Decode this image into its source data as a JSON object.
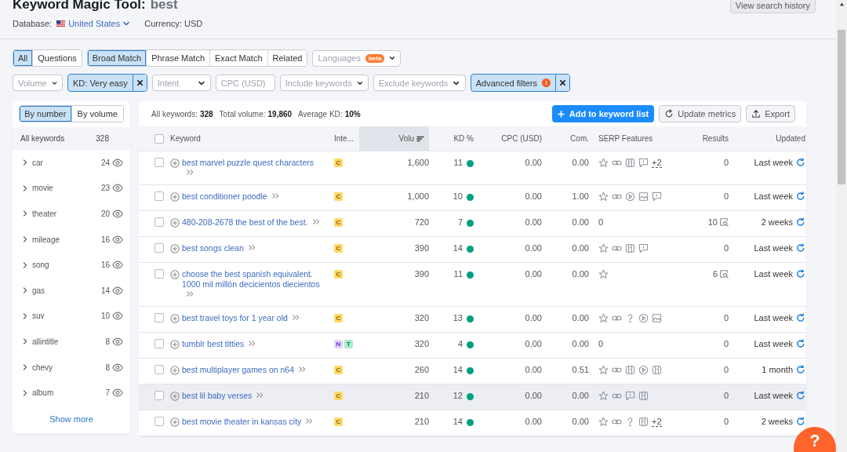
{
  "header": {
    "title": "Keyword Magic Tool:",
    "query": "best",
    "database_label": "Database:",
    "database": "United States",
    "currency": "Currency: USD",
    "history_button": "View search history"
  },
  "type_tabs": [
    {
      "label": "All",
      "selected": true
    },
    {
      "label": "Questions",
      "selected": false
    }
  ],
  "match_tabs": [
    {
      "label": "Broad Match",
      "selected": true
    },
    {
      "label": "Phrase Match",
      "selected": false
    },
    {
      "label": "Exact Match",
      "selected": false
    },
    {
      "label": "Related",
      "selected": false
    }
  ],
  "languages": {
    "placeholder": "Languages",
    "badge": "beta"
  },
  "filters": [
    {
      "label": "Volume",
      "kind": "dropdown"
    },
    {
      "label": "KD: Very easy",
      "kind": "active"
    },
    {
      "label": "Intent",
      "kind": "dropdown"
    },
    {
      "label": "CPC (USD)",
      "kind": "dropdown"
    },
    {
      "label": "Include keywords",
      "kind": "dropdown"
    },
    {
      "label": "Exclude keywords",
      "kind": "dropdown"
    },
    {
      "label": "Advanced filters",
      "kind": "active",
      "badge": "1"
    }
  ],
  "sidebar": {
    "sort_tabs": [
      {
        "label": "By number",
        "selected": true
      },
      {
        "label": "By volume",
        "selected": false
      }
    ],
    "all_label": "All keywords",
    "all_count": "328",
    "groups": [
      {
        "name": "car",
        "count": "24"
      },
      {
        "name": "movie",
        "count": "23"
      },
      {
        "name": "theater",
        "count": "20"
      },
      {
        "name": "mileage",
        "count": "16"
      },
      {
        "name": "song",
        "count": "16"
      },
      {
        "name": "gas",
        "count": "14"
      },
      {
        "name": "suv",
        "count": "10"
      },
      {
        "name": "allintitle",
        "count": "8"
      },
      {
        "name": "chevy",
        "count": "8"
      },
      {
        "name": "album",
        "count": "7"
      }
    ],
    "show_more": "Show more"
  },
  "summary": [
    {
      "label": "All keywords:",
      "value": "328"
    },
    {
      "label": "Total volume:",
      "value": "19,860"
    },
    {
      "label": "Average KD:",
      "value": "10%"
    }
  ],
  "actions": {
    "add": "Add to keyword list",
    "update": "Update metrics",
    "export": "Export"
  },
  "select_all_checked": false,
  "columns": [
    {
      "label": "Keyword",
      "sorted": false
    },
    {
      "label": "Inte...",
      "sorted": false
    },
    {
      "label": "Volu",
      "sorted": true
    },
    {
      "label": "KD %",
      "sorted": false
    },
    {
      "label": "CPC (USD)",
      "sorted": false
    },
    {
      "label": "Com.",
      "sorted": false
    },
    {
      "label": "SERP Features",
      "sorted": false
    },
    {
      "label": "Results",
      "sorted": false
    },
    {
      "label": "Updated",
      "sorted": false
    }
  ],
  "rows": [
    {
      "keyword": "best marvel puzzle quest characters",
      "checked": false,
      "highlighted": false,
      "intents": [
        {
          "letter": "C",
          "kind": "commercial"
        }
      ],
      "volume": "1,600",
      "kd": "11",
      "cpc": "0.00",
      "com": "0.00",
      "serp": [
        {
          "kind": "star"
        },
        {
          "kind": "link"
        },
        {
          "kind": "card"
        },
        {
          "kind": "review"
        }
      ],
      "serp_more": "+2",
      "results": "0",
      "snapshot": false,
      "updated": "Last week"
    },
    {
      "keyword": "best conditioner poodle",
      "checked": false,
      "highlighted": false,
      "intents": [
        {
          "letter": "C",
          "kind": "commercial"
        }
      ],
      "volume": "1,000",
      "kd": "10",
      "cpc": "0.00",
      "com": "1.00",
      "serp": [
        {
          "kind": "star"
        },
        {
          "kind": "link"
        },
        {
          "kind": "video"
        },
        {
          "kind": "image"
        },
        {
          "kind": "review"
        }
      ],
      "results": "0",
      "snapshot": false,
      "updated": "Last week"
    },
    {
      "keyword": "480-208-2678 the best of the best.",
      "checked": false,
      "highlighted": false,
      "intents": [
        {
          "letter": "C",
          "kind": "commercial"
        }
      ],
      "volume": "720",
      "kd": "7",
      "cpc": "0.00",
      "com": "0.00",
      "serp_text": "0",
      "results": "10",
      "snapshot": true,
      "updated": "2 weeks"
    },
    {
      "keyword": "best songs clean",
      "checked": false,
      "highlighted": false,
      "intents": [
        {
          "letter": "C",
          "kind": "commercial"
        }
      ],
      "volume": "390",
      "kd": "14",
      "cpc": "0.00",
      "com": "0.00",
      "serp": [
        {
          "kind": "star"
        },
        {
          "kind": "link"
        },
        {
          "kind": "card"
        },
        {
          "kind": "review"
        }
      ],
      "results": "0",
      "snapshot": false,
      "updated": "Last week"
    },
    {
      "keyword": "choose the best spanish equivalent. 1000 mil millón decicientos diecientos",
      "checked": false,
      "highlighted": false,
      "intents": [
        {
          "letter": "C",
          "kind": "commercial"
        }
      ],
      "volume": "390",
      "kd": "11",
      "cpc": "0.00",
      "com": "0.00",
      "serp": [
        {
          "kind": "star"
        }
      ],
      "results": "6",
      "snapshot": true,
      "updated": "Last week"
    },
    {
      "keyword": "best travel toys for 1 year old",
      "checked": false,
      "highlighted": false,
      "intents": [
        {
          "letter": "C",
          "kind": "commercial"
        }
      ],
      "volume": "320",
      "kd": "13",
      "cpc": "0.00",
      "com": "0.00",
      "serp": [
        {
          "kind": "star"
        },
        {
          "kind": "link"
        },
        {
          "kind": "question"
        },
        {
          "kind": "video"
        },
        {
          "kind": "image"
        }
      ],
      "results": "0",
      "snapshot": false,
      "updated": "Last week"
    },
    {
      "keyword": "tumblr best titties",
      "checked": false,
      "highlighted": false,
      "intents": [
        {
          "letter": "N",
          "kind": "navigational"
        },
        {
          "letter": "T",
          "kind": "transactional"
        }
      ],
      "volume": "320",
      "kd": "4",
      "cpc": "0.00",
      "com": "0.00",
      "serp_text": "0",
      "results": "0",
      "snapshot": false,
      "updated": "Last week"
    },
    {
      "keyword": "best multiplayer games on n64",
      "checked": false,
      "highlighted": false,
      "intents": [
        {
          "letter": "C",
          "kind": "commercial"
        }
      ],
      "volume": "260",
      "kd": "14",
      "cpc": "0.00",
      "com": "0.51",
      "serp": [
        {
          "kind": "star"
        },
        {
          "kind": "link"
        },
        {
          "kind": "card"
        },
        {
          "kind": "video"
        },
        {
          "kind": "card"
        }
      ],
      "results": "0",
      "snapshot": false,
      "updated": "1 month"
    },
    {
      "keyword": "best lil baby verses",
      "checked": false,
      "highlighted": true,
      "intents": [
        {
          "letter": "C",
          "kind": "commercial"
        }
      ],
      "volume": "210",
      "kd": "12",
      "cpc": "0.00",
      "com": "0.00",
      "serp": [
        {
          "kind": "star"
        },
        {
          "kind": "link"
        },
        {
          "kind": "review"
        },
        {
          "kind": "card"
        }
      ],
      "results": "0",
      "snapshot": false,
      "updated": "Last week"
    },
    {
      "keyword": "best movie theater in kansas city",
      "checked": false,
      "highlighted": false,
      "intents": [
        {
          "letter": "C",
          "kind": "commercial"
        }
      ],
      "volume": "210",
      "kd": "14",
      "cpc": "0.00",
      "com": "0.00",
      "serp": [
        {
          "kind": "star"
        },
        {
          "kind": "link"
        },
        {
          "kind": "question"
        },
        {
          "kind": "card"
        }
      ],
      "serp_more": "+2",
      "results": "0",
      "snapshot": false,
      "updated": "2 weeks"
    }
  ],
  "help_button": "?"
}
